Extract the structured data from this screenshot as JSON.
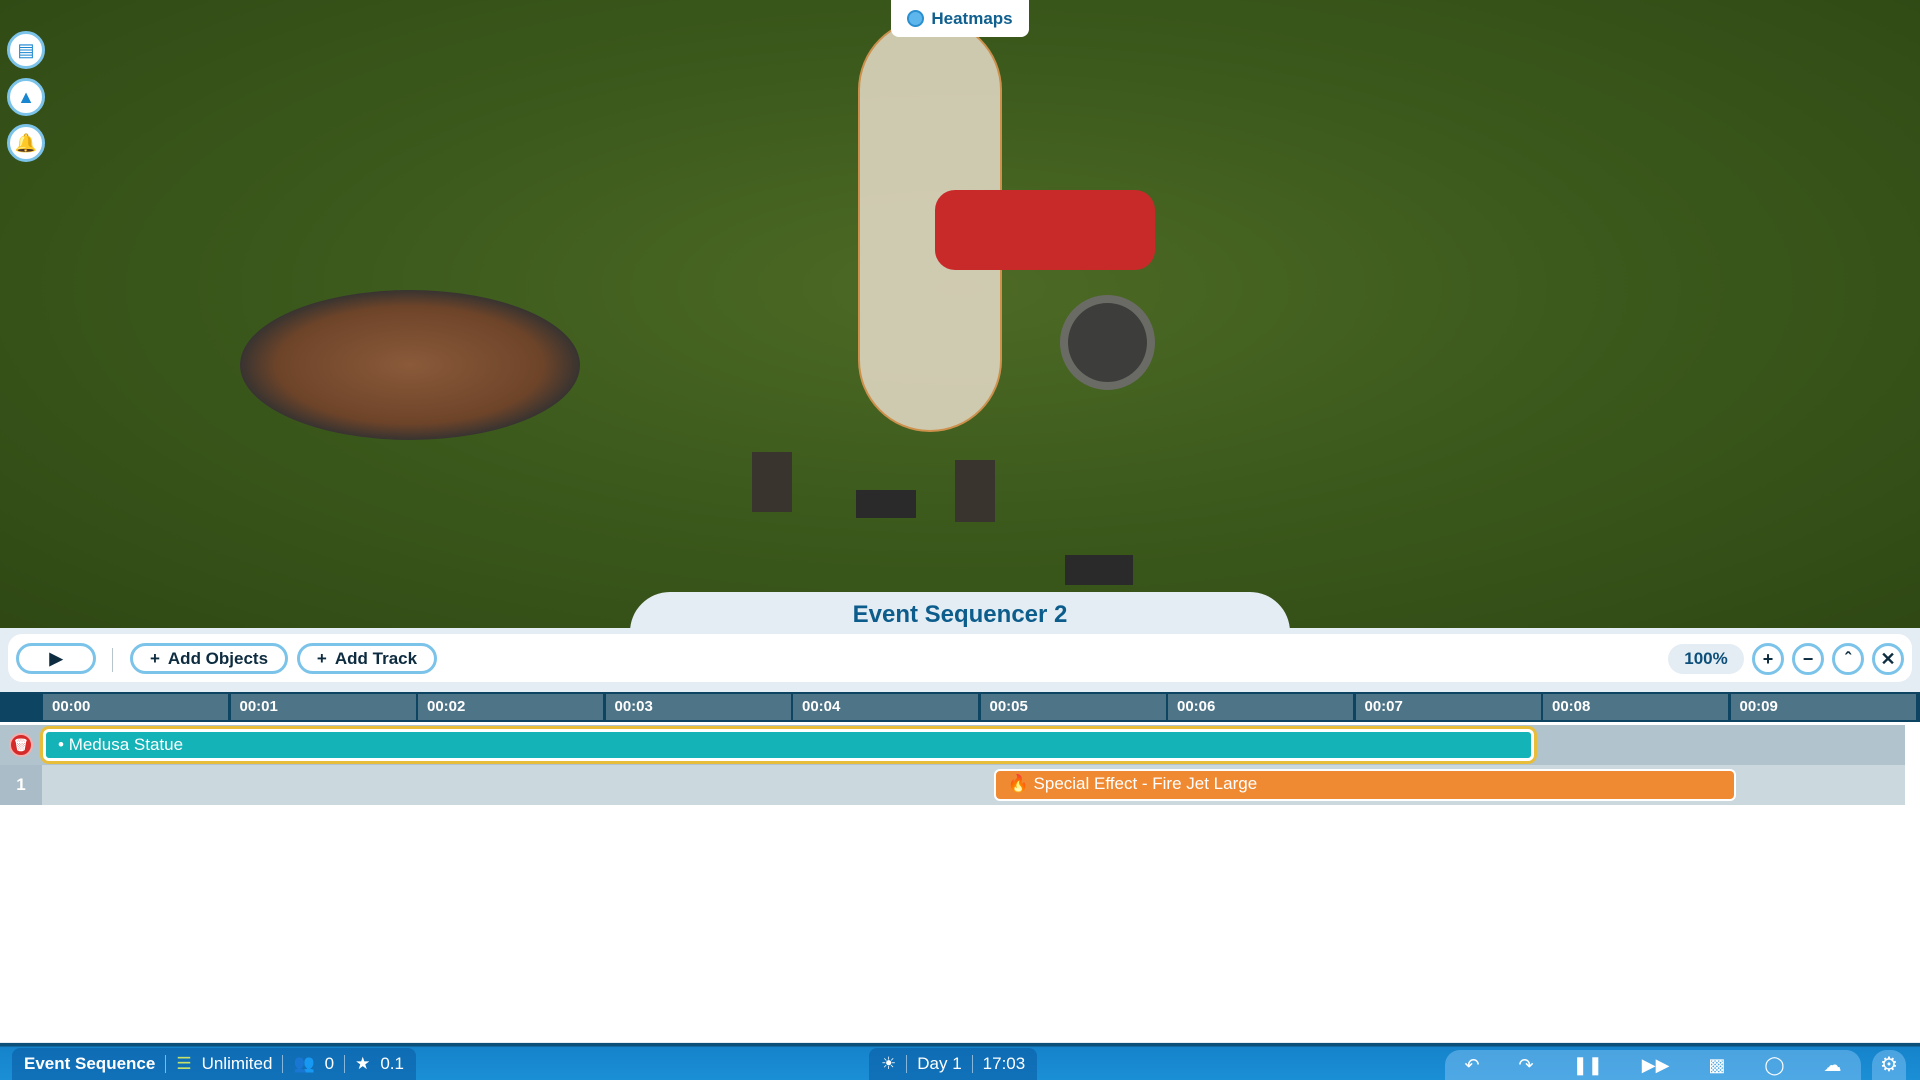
{
  "scene": {
    "heatmaps_label": "Heatmaps"
  },
  "side_buttons": [
    {
      "icon": "clipboard-icon"
    },
    {
      "icon": "terrain-add-icon"
    },
    {
      "icon": "bell-icon"
    }
  ],
  "sequencer": {
    "title": "Event Sequencer 2",
    "toolbar": {
      "add_objects": "Add Objects",
      "add_track": "Add Track",
      "zoom": "100%"
    },
    "ruler": [
      "00:00",
      "00:01",
      "00:02",
      "00:03",
      "00:04",
      "00:05",
      "00:06",
      "00:07",
      "00:08",
      "00:09"
    ],
    "tracks": [
      {
        "header": "",
        "clip": {
          "label": "Medusa Statue",
          "start_s": 0,
          "end_s": 7.95,
          "color": "#13b3b7",
          "selected": true
        }
      },
      {
        "header": "1",
        "clip": {
          "label": "Special Effect - Fire Jet Large",
          "start_s": 5.07,
          "end_s": 9.03,
          "color": "#ef8a33",
          "selected": false
        }
      }
    ]
  },
  "statusbar": {
    "mode": "Event Sequence",
    "money": "Unlimited",
    "guests": "0",
    "rating": "0.1",
    "day": "Day 1",
    "time": "17:03"
  },
  "colors": {
    "accent": "#1a86d0",
    "title": "#0d5d8c",
    "ruler": "#4e7487"
  }
}
